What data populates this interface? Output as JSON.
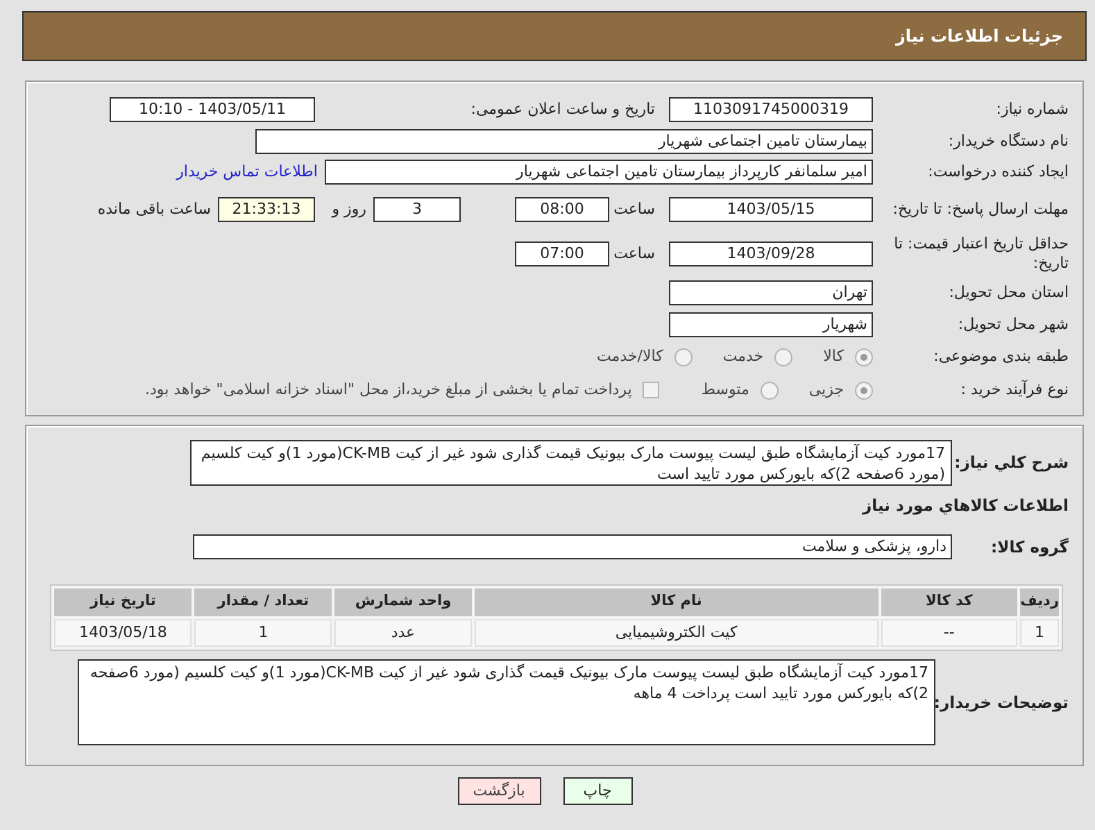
{
  "header": {
    "title": "جزئیات اطلاعات نیاز"
  },
  "rows": [
    {
      "label": "شماره نیاز:",
      "items": [
        {
          "kind": "field",
          "value": "1103091745000319"
        },
        {
          "kind": "text",
          "text": "تاریخ و ساعت اعلان عمومی:"
        },
        {
          "kind": "field",
          "value": "1403/05/11 - 10:10"
        }
      ]
    },
    {
      "label": "نام دستگاه خریدار:",
      "items": [
        {
          "kind": "field",
          "value": "بیمارستان تامین اجتماعی شهریار"
        }
      ]
    },
    {
      "label": "ایجاد کننده درخواست:",
      "items": [
        {
          "kind": "field",
          "value": "امیر سلمانفر کارپرداز بیمارستان تامین اجتماعی شهریار"
        },
        {
          "kind": "link",
          "text": "اطلاعات تماس خریدار"
        }
      ]
    },
    {
      "label": "مهلت ارسال پاسخ: تا تاریخ:",
      "items": [
        {
          "kind": "field",
          "value": "1403/05/15"
        },
        {
          "kind": "text",
          "text": "ساعت"
        },
        {
          "kind": "field",
          "value": "08:00"
        },
        {
          "kind": "field",
          "value": "3"
        },
        {
          "kind": "text",
          "text": "روز و"
        },
        {
          "kind": "counter",
          "value": "21:33:13"
        },
        {
          "kind": "text",
          "text": "ساعت باقی مانده"
        }
      ]
    },
    {
      "label": "حداقل تاریخ اعتبار قیمت: تا تاریخ:",
      "items": [
        {
          "kind": "field",
          "value": "1403/09/28"
        },
        {
          "kind": "text",
          "text": "ساعت"
        },
        {
          "kind": "field",
          "value": "07:00"
        }
      ]
    },
    {
      "label": "استان محل تحویل:",
      "items": [
        {
          "kind": "field",
          "value": "تهران"
        }
      ]
    },
    {
      "label": "شهر محل تحویل:",
      "items": [
        {
          "kind": "field",
          "value": "شهریار"
        }
      ]
    },
    {
      "label": "طبقه بندی موضوعی:",
      "items": [
        {
          "kind": "radio",
          "text": "کالا",
          "selected": true,
          "disabled": true
        },
        {
          "kind": "radio",
          "text": "خدمت",
          "selected": false,
          "disabled": true
        },
        {
          "kind": "radio",
          "text": "کالا/خدمت",
          "selected": false,
          "disabled": true
        }
      ]
    },
    {
      "label": "نوع فرآیند خرید :",
      "items": [
        {
          "kind": "radio",
          "text": "جزیی",
          "selected": true,
          "disabled": true
        },
        {
          "kind": "radio",
          "text": "متوسط",
          "selected": false,
          "disabled": true
        },
        {
          "kind": "checkbox",
          "text": "پرداخت تمام یا بخشی از مبلغ خرید،از محل \"اسناد خزانه اسلامی\" خواهد بود.",
          "checked": false,
          "disabled": true
        }
      ]
    }
  ],
  "summary": {
    "label": "شرح کلي نياز:",
    "value": "17مورد کیت آزمایشگاه طبق لیست پیوست مارک بیونیک قیمت گذاری شود غیر از کیت CK-MB(مورد 1)و کیت کلسیم (مورد 6صفحه 2)که بایورکس مورد تایید است"
  },
  "goods_heading": "اطلاعات کالاهاي مورد نياز",
  "goods_group": {
    "label": "گروه کالا:",
    "value": "دارو، پزشکی و سلامت"
  },
  "table": {
    "columns": [
      "ردیف",
      "کد کالا",
      "نام کالا",
      "واحد شمارش",
      "تعداد / مقدار",
      "تاریخ نیاز"
    ],
    "rows": [
      [
        "1",
        "--",
        "کیت الکتروشیمیایی",
        "عدد",
        "1",
        "1403/05/18"
      ]
    ]
  },
  "buyer_notes": {
    "label": "توضیحات خریدار:",
    "value": "17مورد کیت آزمایشگاه طبق لیست پیوست مارک بیونیک قیمت گذاری شود غیر از کیت CK-MB(مورد 1)و کیت کلسیم (مورد 6صفحه 2)که بایورکس مورد تایید است پرداخت 4 ماهه"
  },
  "buttons": [
    {
      "kind": "print",
      "label": "چاپ"
    },
    {
      "kind": "back",
      "label": "بازگشت"
    }
  ]
}
